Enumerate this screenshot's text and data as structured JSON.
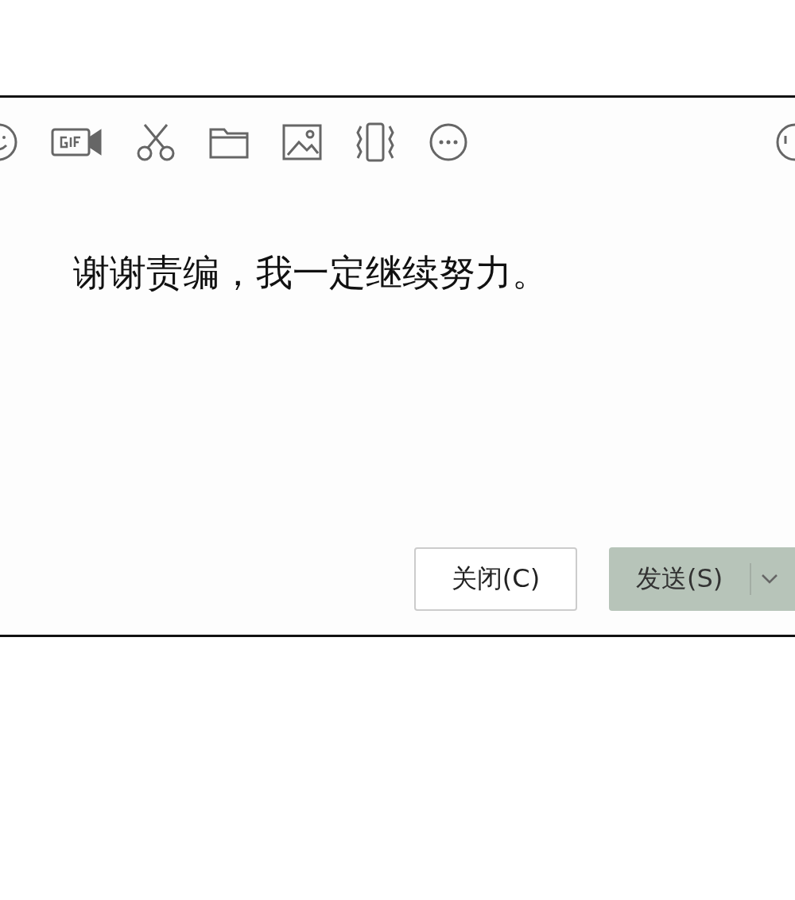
{
  "message": {
    "text": "谢谢责编，我一定继续努力。"
  },
  "buttons": [
    {
      "kind": "close",
      "label": "关闭(C)"
    },
    {
      "kind": "send",
      "label": "发送(S)"
    }
  ]
}
